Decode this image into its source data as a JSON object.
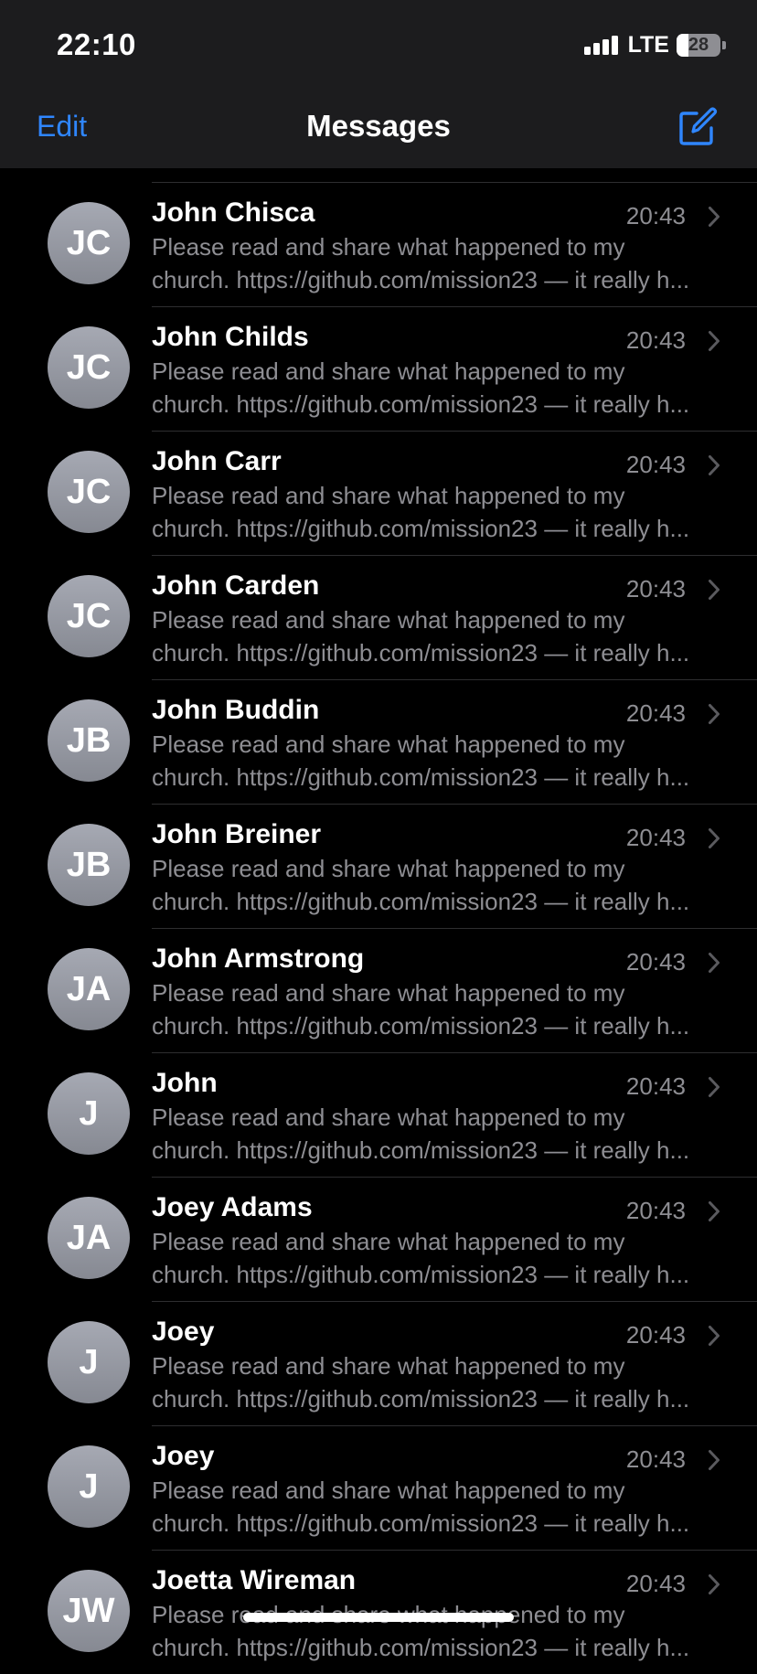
{
  "status_bar": {
    "time": "22:10",
    "network": "LTE",
    "battery_level": "28",
    "battery_fraction": 0.28
  },
  "nav": {
    "edit_label": "Edit",
    "title": "Messages",
    "compose_icon": "compose-icon"
  },
  "colors": {
    "accent": "#2f86ff",
    "background": "#000000",
    "header_background": "#1c1c1e",
    "secondary_text": "#8e8e93"
  },
  "conversations": [
    {
      "initials": "JC",
      "name": "John Chisca",
      "time": "20:43",
      "preview_line1": "Please read and share what happened to my",
      "preview_line2": "church. https://github.com/mission23 — it really h..."
    },
    {
      "initials": "JC",
      "name": "John Childs",
      "time": "20:43",
      "preview_line1": "Please read and share what happened to my",
      "preview_line2": "church. https://github.com/mission23 — it really h..."
    },
    {
      "initials": "JC",
      "name": "John Carr",
      "time": "20:43",
      "preview_line1": "Please read and share what happened to my",
      "preview_line2": "church. https://github.com/mission23 — it really h..."
    },
    {
      "initials": "JC",
      "name": "John Carden",
      "time": "20:43",
      "preview_line1": "Please read and share what happened to my",
      "preview_line2": "church. https://github.com/mission23 — it really h..."
    },
    {
      "initials": "JB",
      "name": "John Buddin",
      "time": "20:43",
      "preview_line1": "Please read and share what happened to my",
      "preview_line2": "church. https://github.com/mission23 — it really h..."
    },
    {
      "initials": "JB",
      "name": "John Breiner",
      "time": "20:43",
      "preview_line1": "Please read and share what happened to my",
      "preview_line2": "church. https://github.com/mission23 — it really h..."
    },
    {
      "initials": "JA",
      "name": "John Armstrong",
      "time": "20:43",
      "preview_line1": "Please read and share what happened to my",
      "preview_line2": "church. https://github.com/mission23 — it really h..."
    },
    {
      "initials": "J",
      "name": "John",
      "time": "20:43",
      "preview_line1": "Please read and share what happened to my",
      "preview_line2": "church. https://github.com/mission23 — it really h..."
    },
    {
      "initials": "JA",
      "name": "Joey Adams",
      "time": "20:43",
      "preview_line1": "Please read and share what happened to my",
      "preview_line2": "church. https://github.com/mission23 — it really h..."
    },
    {
      "initials": "J",
      "name": "Joey",
      "time": "20:43",
      "preview_line1": "Please read and share what happened to my",
      "preview_line2": "church. https://github.com/mission23 — it really h..."
    },
    {
      "initials": "J",
      "name": "Joey",
      "time": "20:43",
      "preview_line1": "Please read and share what happened to my",
      "preview_line2": "church. https://github.com/mission23 — it really h..."
    },
    {
      "initials": "JW",
      "name": "Joetta Wireman",
      "time": "20:43",
      "preview_line1": "Please read and share what happened to my",
      "preview_line2": "church. https://github.com/mission23 — it really h..."
    }
  ]
}
